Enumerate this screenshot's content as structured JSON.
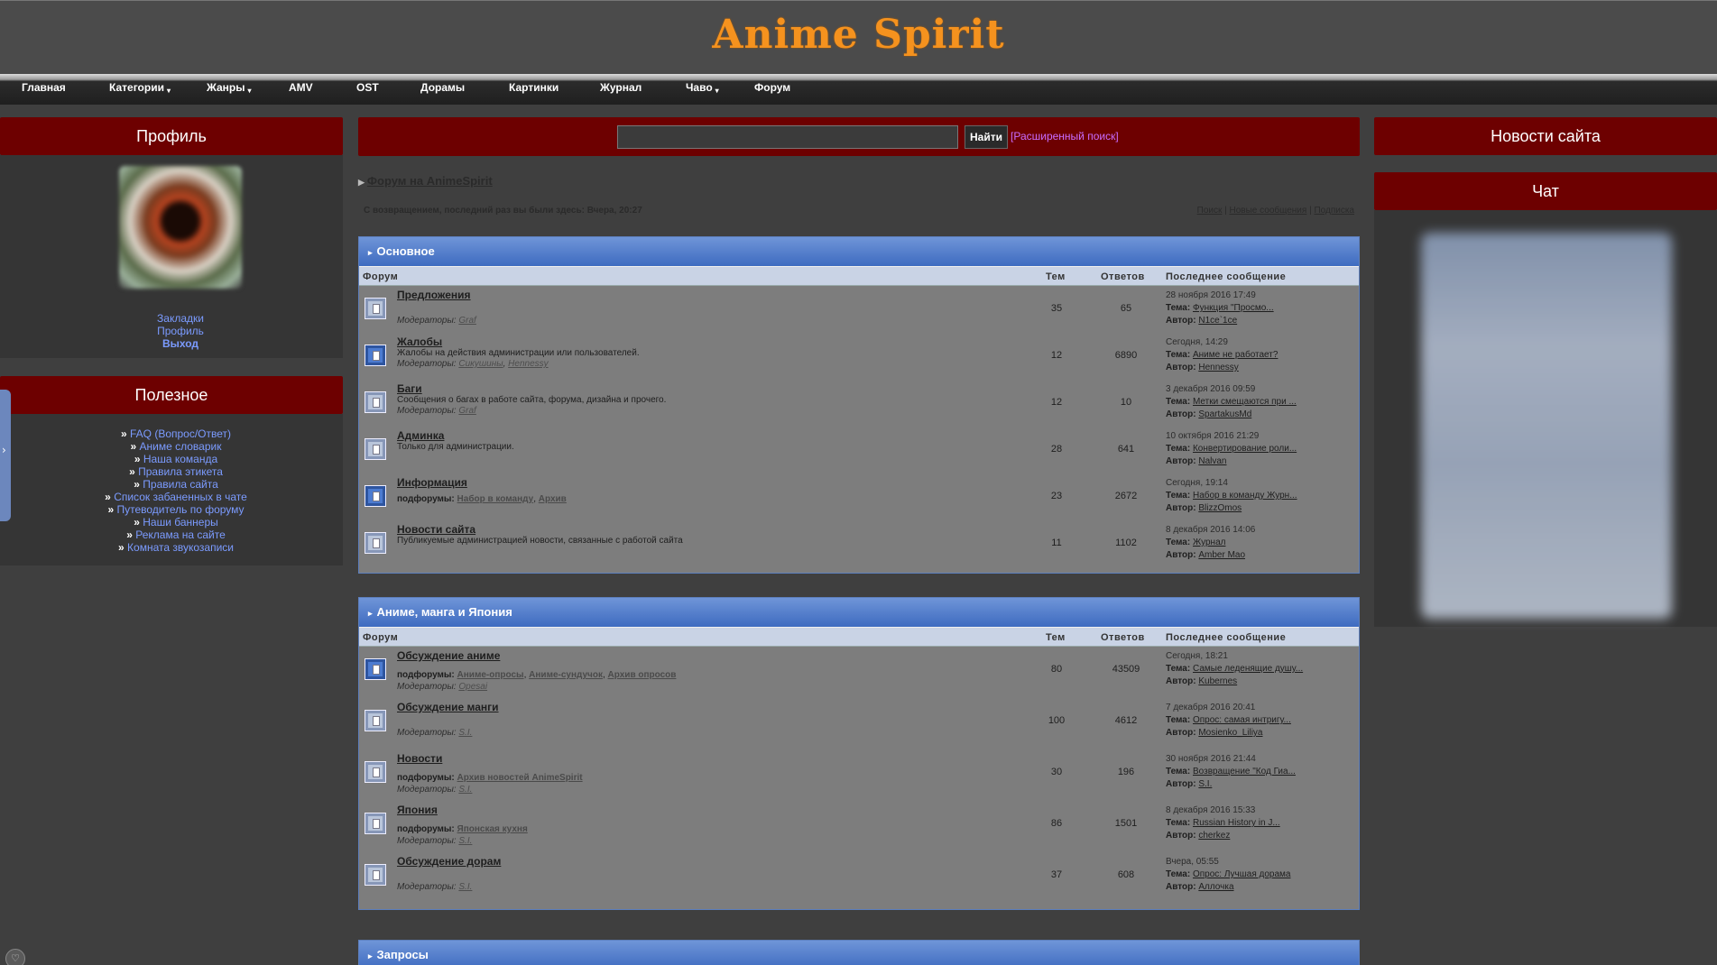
{
  "site": {
    "title": "Anime Spirit"
  },
  "nav": [
    {
      "label": "Главная",
      "dropdown": false
    },
    {
      "label": "Категории",
      "dropdown": true
    },
    {
      "label": "Жанры",
      "dropdown": true
    },
    {
      "label": "AMV",
      "dropdown": false
    },
    {
      "label": "OST",
      "dropdown": false
    },
    {
      "label": "Дорамы",
      "dropdown": false
    },
    {
      "label": "Картинки",
      "dropdown": false
    },
    {
      "label": "Журнал",
      "dropdown": false
    },
    {
      "label": "Чаво",
      "dropdown": true
    },
    {
      "label": "Форум",
      "dropdown": false
    }
  ],
  "profile": {
    "title": "Профиль",
    "links": [
      "Закладки",
      "Профиль",
      "Выход"
    ]
  },
  "useful": {
    "title": "Полезное",
    "links": [
      "FAQ (Вопрос/Ответ)",
      "Аниме словарик",
      "Наша команда",
      "Правила этикета",
      "Правила сайта",
      "Список забаненных в чате",
      "Путеводитель по форуму",
      "Наши баннеры",
      "Реклама на сайте",
      "Комната звукозаписи"
    ]
  },
  "search": {
    "button": "Найти",
    "advanced": "[Расширенный поиск]",
    "value": ""
  },
  "breadcrumb": "Форум на AnimeSpirit",
  "welcome": "С возвращением, последний раз вы были здесь: Вчера, 20:27",
  "quicklinks": [
    "Поиск",
    "Новые сообщения",
    "Подписка"
  ],
  "columns": {
    "forum": "Форум",
    "topics": "Тем",
    "replies": "Ответов",
    "last": "Последнее сообщение"
  },
  "right": {
    "news_title": "Новости сайта",
    "chat_title": "Чат"
  },
  "labels": {
    "moderators": "Модераторы:",
    "subforums": "подфорумы:",
    "topic": "Тема:",
    "author": "Автор:"
  },
  "categories": [
    {
      "title": "Основное",
      "forums": [
        {
          "name": "Предложения",
          "desc": "",
          "subforums": [],
          "moderators": [
            "Graf"
          ],
          "topics": "35",
          "replies": "65",
          "date": "28 ноября 2016 17:49",
          "topic": "Функция \"Просмо...",
          "author": "N1ce`1ce",
          "new": false
        },
        {
          "name": "Жалобы",
          "desc": "Жалобы на действия администрации или пользователей.",
          "subforums": [],
          "moderators": [
            "Сикушины",
            "Hennessy"
          ],
          "topics": "12",
          "replies": "6890",
          "date": "Сегодня, 14:29",
          "topic": "Аниме не работает?",
          "author": "Hennessy",
          "new": true
        },
        {
          "name": "Баги",
          "desc": "Сообщения о багах в работе сайта, форума, дизайна и прочего.",
          "subforums": [],
          "moderators": [
            "Graf"
          ],
          "topics": "12",
          "replies": "10",
          "date": "3 декабря 2016 09:59",
          "topic": "Метки смещаются при ...",
          "author": "SpartakusMd",
          "new": false
        },
        {
          "name": "Админка",
          "desc": "Только для администрации.",
          "subforums": [],
          "moderators": [],
          "topics": "28",
          "replies": "641",
          "date": "10 октября 2016 21:29",
          "topic": "Конвертирование роли...",
          "author": "Nalvan",
          "new": false
        },
        {
          "name": "Информация",
          "desc": "",
          "subforums": [
            "Набор в команду",
            "Архив"
          ],
          "moderators": [],
          "topics": "23",
          "replies": "2672",
          "date": "Сегодня, 19:14",
          "topic": "Набор в команду Журн...",
          "author": "BlizzOmos",
          "new": true
        },
        {
          "name": "Новости сайта",
          "desc": "Публикуемые администрацией новости, связанные с работой сайта",
          "subforums": [],
          "moderators": [],
          "topics": "11",
          "replies": "1102",
          "date": "8 декабря 2016 14:06",
          "topic": "Журнал",
          "author": "Amber Mao",
          "new": false
        }
      ]
    },
    {
      "title": "Аниме, манга и Япония",
      "forums": [
        {
          "name": "Обсуждение аниме",
          "desc": "",
          "subforums": [
            "Аниме-опросы",
            "Аниме-сундучок",
            "Архив опросов"
          ],
          "moderators": [
            "Opesai"
          ],
          "topics": "80",
          "replies": "43509",
          "date": "Сегодня, 18:21",
          "topic": "Самые леденящие душу...",
          "author": "Kubernes",
          "new": true
        },
        {
          "name": "Обсуждение манги",
          "desc": "",
          "subforums": [],
          "moderators": [
            "S.I."
          ],
          "topics": "100",
          "replies": "4612",
          "date": "7 декабря 2016 20:41",
          "topic": "Опрос: самая интригу...",
          "author": "Mosienko_Liliya",
          "new": false
        },
        {
          "name": "Новости",
          "desc": "",
          "subforums": [
            "Архив новостей AnimeSpirit"
          ],
          "moderators": [
            "S.I."
          ],
          "topics": "30",
          "replies": "196",
          "date": "30 ноября 2016 21:44",
          "topic": "Возвращение \"Код Гиа...",
          "author": "S.I.",
          "new": false
        },
        {
          "name": "Япония",
          "desc": "",
          "subforums": [
            "Японская кухня"
          ],
          "moderators": [
            "S.I."
          ],
          "topics": "86",
          "replies": "1501",
          "date": "8 декабря 2016 15:33",
          "topic": "Russian History in J...",
          "author": "cherkez",
          "new": false
        },
        {
          "name": "Обсуждение дорам",
          "desc": "",
          "subforums": [],
          "moderators": [
            "S.I."
          ],
          "topics": "37",
          "replies": "608",
          "date": "Вчера, 05:55",
          "topic": "Опрос: Лучшая дорама",
          "author": "Аллочка",
          "new": false
        }
      ]
    },
    {
      "title": "Запросы",
      "forums": []
    }
  ],
  "colors": {
    "accent": "#6d0000",
    "logo": "#f5921e",
    "category": "#3e6bc0",
    "link": "#7b9bff"
  }
}
